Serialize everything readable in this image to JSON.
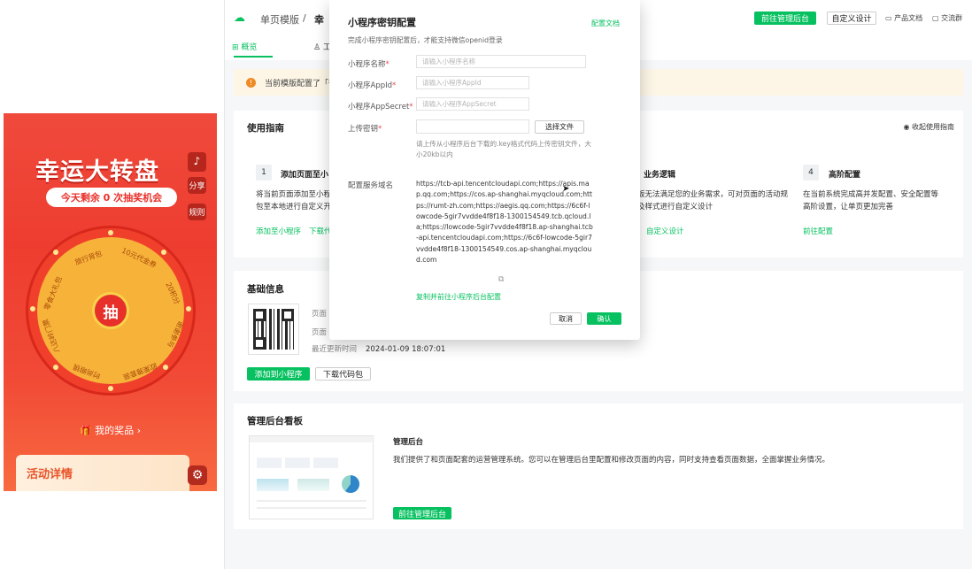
{
  "preview": {
    "title": "幸运大转盘",
    "remaining": "今天剩余 0 次抽奖机会",
    "side_buttons": [
      "分享",
      "规则"
    ],
    "wheel_segments": [
      "旅行背包",
      "10元代金券",
      "20积分",
      "谢谢参与",
      "欧莱雅套装",
      "时尚眼镜",
      "八达岭门票",
      "零食大礼包"
    ],
    "draw_label": "抽",
    "my_prizes": "我的奖品",
    "activity_details": "活动详情"
  },
  "header": {
    "breadcrumb_parent": "单页模版",
    "breadcrumb_sep": "/",
    "breadcrumb_current": "幸",
    "go_admin": "前往管理后台",
    "customize": "自定义设计",
    "product_docs": "产品文档",
    "community": "交流群"
  },
  "tabs": [
    "概览",
    "工"
  ],
  "notice": "当前模版配置了「微",
  "guide": {
    "title": "使用指南",
    "collapse": "收起使用指南",
    "steps": [
      {
        "num": "1",
        "title": "添加页面至小",
        "desc": "将当前页面添加至小程\n包至本地进行自定义开",
        "links": [
          "添加至小程序",
          "下载代"
        ]
      },
      {
        "num": "",
        "title": "业务逻辑",
        "desc": "板无法满足您的业务需求，可对页面的活动规\n及样式进行自定义设计",
        "links": [
          "自定义设计"
        ]
      },
      {
        "num": "4",
        "title": "高阶配置",
        "desc": "在当前系统完成高并发配置、安全配置等\n高阶设置，让单页更加完善",
        "links": [
          "前往配置"
        ]
      }
    ]
  },
  "basic": {
    "title": "基础信息",
    "field1": "页面",
    "field2": "页面",
    "updated_label": "最近更新时间",
    "updated_value": "2024-01-09 18:07:01",
    "add_btn": "添加到小程序",
    "download_btn": "下载代码包"
  },
  "dashboard": {
    "title": "管理后台看板",
    "sub_title": "管理后台",
    "desc": "我们提供了和页面配套的运营管理系统。您可以在管理后台里配置和修改页面的内容，同时支持查看页面数据，全面掌握业务情况。",
    "go_btn": "前往管理后台"
  },
  "modal": {
    "title": "小程序密钥配置",
    "doc_link": "配置文档",
    "subtitle": "完成小程序密钥配置后，才能支持微信openid登录",
    "name_label": "小程序名称",
    "name_placeholder": "请输入小程序名称",
    "appid_label": "小程序AppId",
    "appid_placeholder": "请输入小程序AppId",
    "secret_label": "小程序AppSecret",
    "secret_placeholder": "请输入小程序AppSecret",
    "key_label": "上传密钥",
    "choose_file": "选择文件",
    "key_hint": "请上传从小程序后台下载的.key格式代码上传密钥文件，大小20kb以内",
    "domain_label": "配置服务域名",
    "domains": "https://tcb-api.tencentcloudapi.com;https://apis.map.qq.com;https://cos.ap-shanghai.myqcloud.com;https://rumt-zh.com;https://aegis.qq.com;https://6c6f-lowcode-5gir7vvdde4f8f18-1300154549.tcb.qcloud.la;https://lowcode-5gir7vvdde4f8f18.ap-shanghai.tcb-api.tencentcloudapi.com;https://6c6f-lowcode-5gir7vvdde4f8f18-1300154549.cos.ap-shanghai.myqcloud.com",
    "copy_link": "复制并前往小程序后台配置",
    "cancel": "取消",
    "confirm": "确认",
    "required_mark": "*"
  },
  "colors": {
    "accent": "#07c160",
    "preview_red": "#ee3d30",
    "notice_bg": "#fdf6e6"
  }
}
